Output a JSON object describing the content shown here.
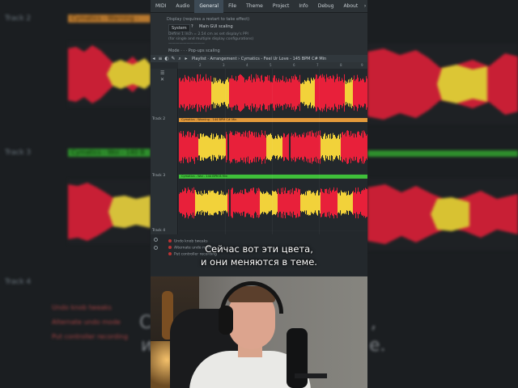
{
  "menu": {
    "tabs": [
      "MIDI",
      "Audio",
      "General",
      "File",
      "Theme",
      "Project",
      "Info",
      "Debug",
      "About"
    ],
    "active_tab": "General",
    "next_arrow": "›"
  },
  "settings": {
    "section_header": "Display (requires a restart to take effect)",
    "scaling_dropdown": "System",
    "scaling_help": "?",
    "scaling_option": "Main GUI scaling",
    "info_lines": [
      "Define 1 inch = 2.54 cm as set display's PPI",
      "(for single and multiple display configurations)",
      "——————————"
    ],
    "mode_row": "Mode · · · Pop-ups scaling"
  },
  "playlist": {
    "toolbar_icons": [
      "◂",
      "≡",
      "◐",
      "✎",
      "⌕",
      "▸"
    ],
    "breadcrumb": "Playlist · Arrangement › Cymatics - Feel Ur Love - 145 BPM C# Min",
    "ruler_marks": [
      "2",
      "3",
      "4",
      "5",
      "6",
      "7",
      "8",
      "9"
    ],
    "tracks": [
      {
        "label": "",
        "clip_title": ""
      },
      {
        "label": "Track 2",
        "clip_title": "Cymatics - Warning - 144 BPM C# Min"
      },
      {
        "label": "Track 3",
        "clip_title": "Cymatics - Woi - 144 BPM B Min"
      }
    ],
    "left_icons": [
      "☰",
      "✕"
    ],
    "track4_label": "Track 4",
    "options": [
      "Undo knob tweaks",
      "Alternate undo mode",
      "Put controller recording"
    ]
  },
  "subtitle": {
    "line1": "Сейчас вот эти цвета,",
    "line2": "и они меняются в теме."
  },
  "background": {
    "left_track2": "Track 2",
    "left_track3": "Track 3",
    "left_track4": "Track 4",
    "left_clip2": "Cymatics - Warning -",
    "left_clip3": "Cymatics - Woi - 140 B",
    "big_sub_left": "С",
    "big_sub_left2": "и",
    "big_sub_right": ",",
    "big_sub_right2": "e.",
    "opts": [
      "Undo knob tweaks",
      "Alternate undo mode",
      "Put controller recording"
    ]
  },
  "colors": {
    "clip_orange": "#e39a3b",
    "clip_green": "#3fbf3a",
    "wave_red": "#e8203a",
    "wave_yellow": "#f2d23a",
    "menu_active": "#3d4a55"
  }
}
